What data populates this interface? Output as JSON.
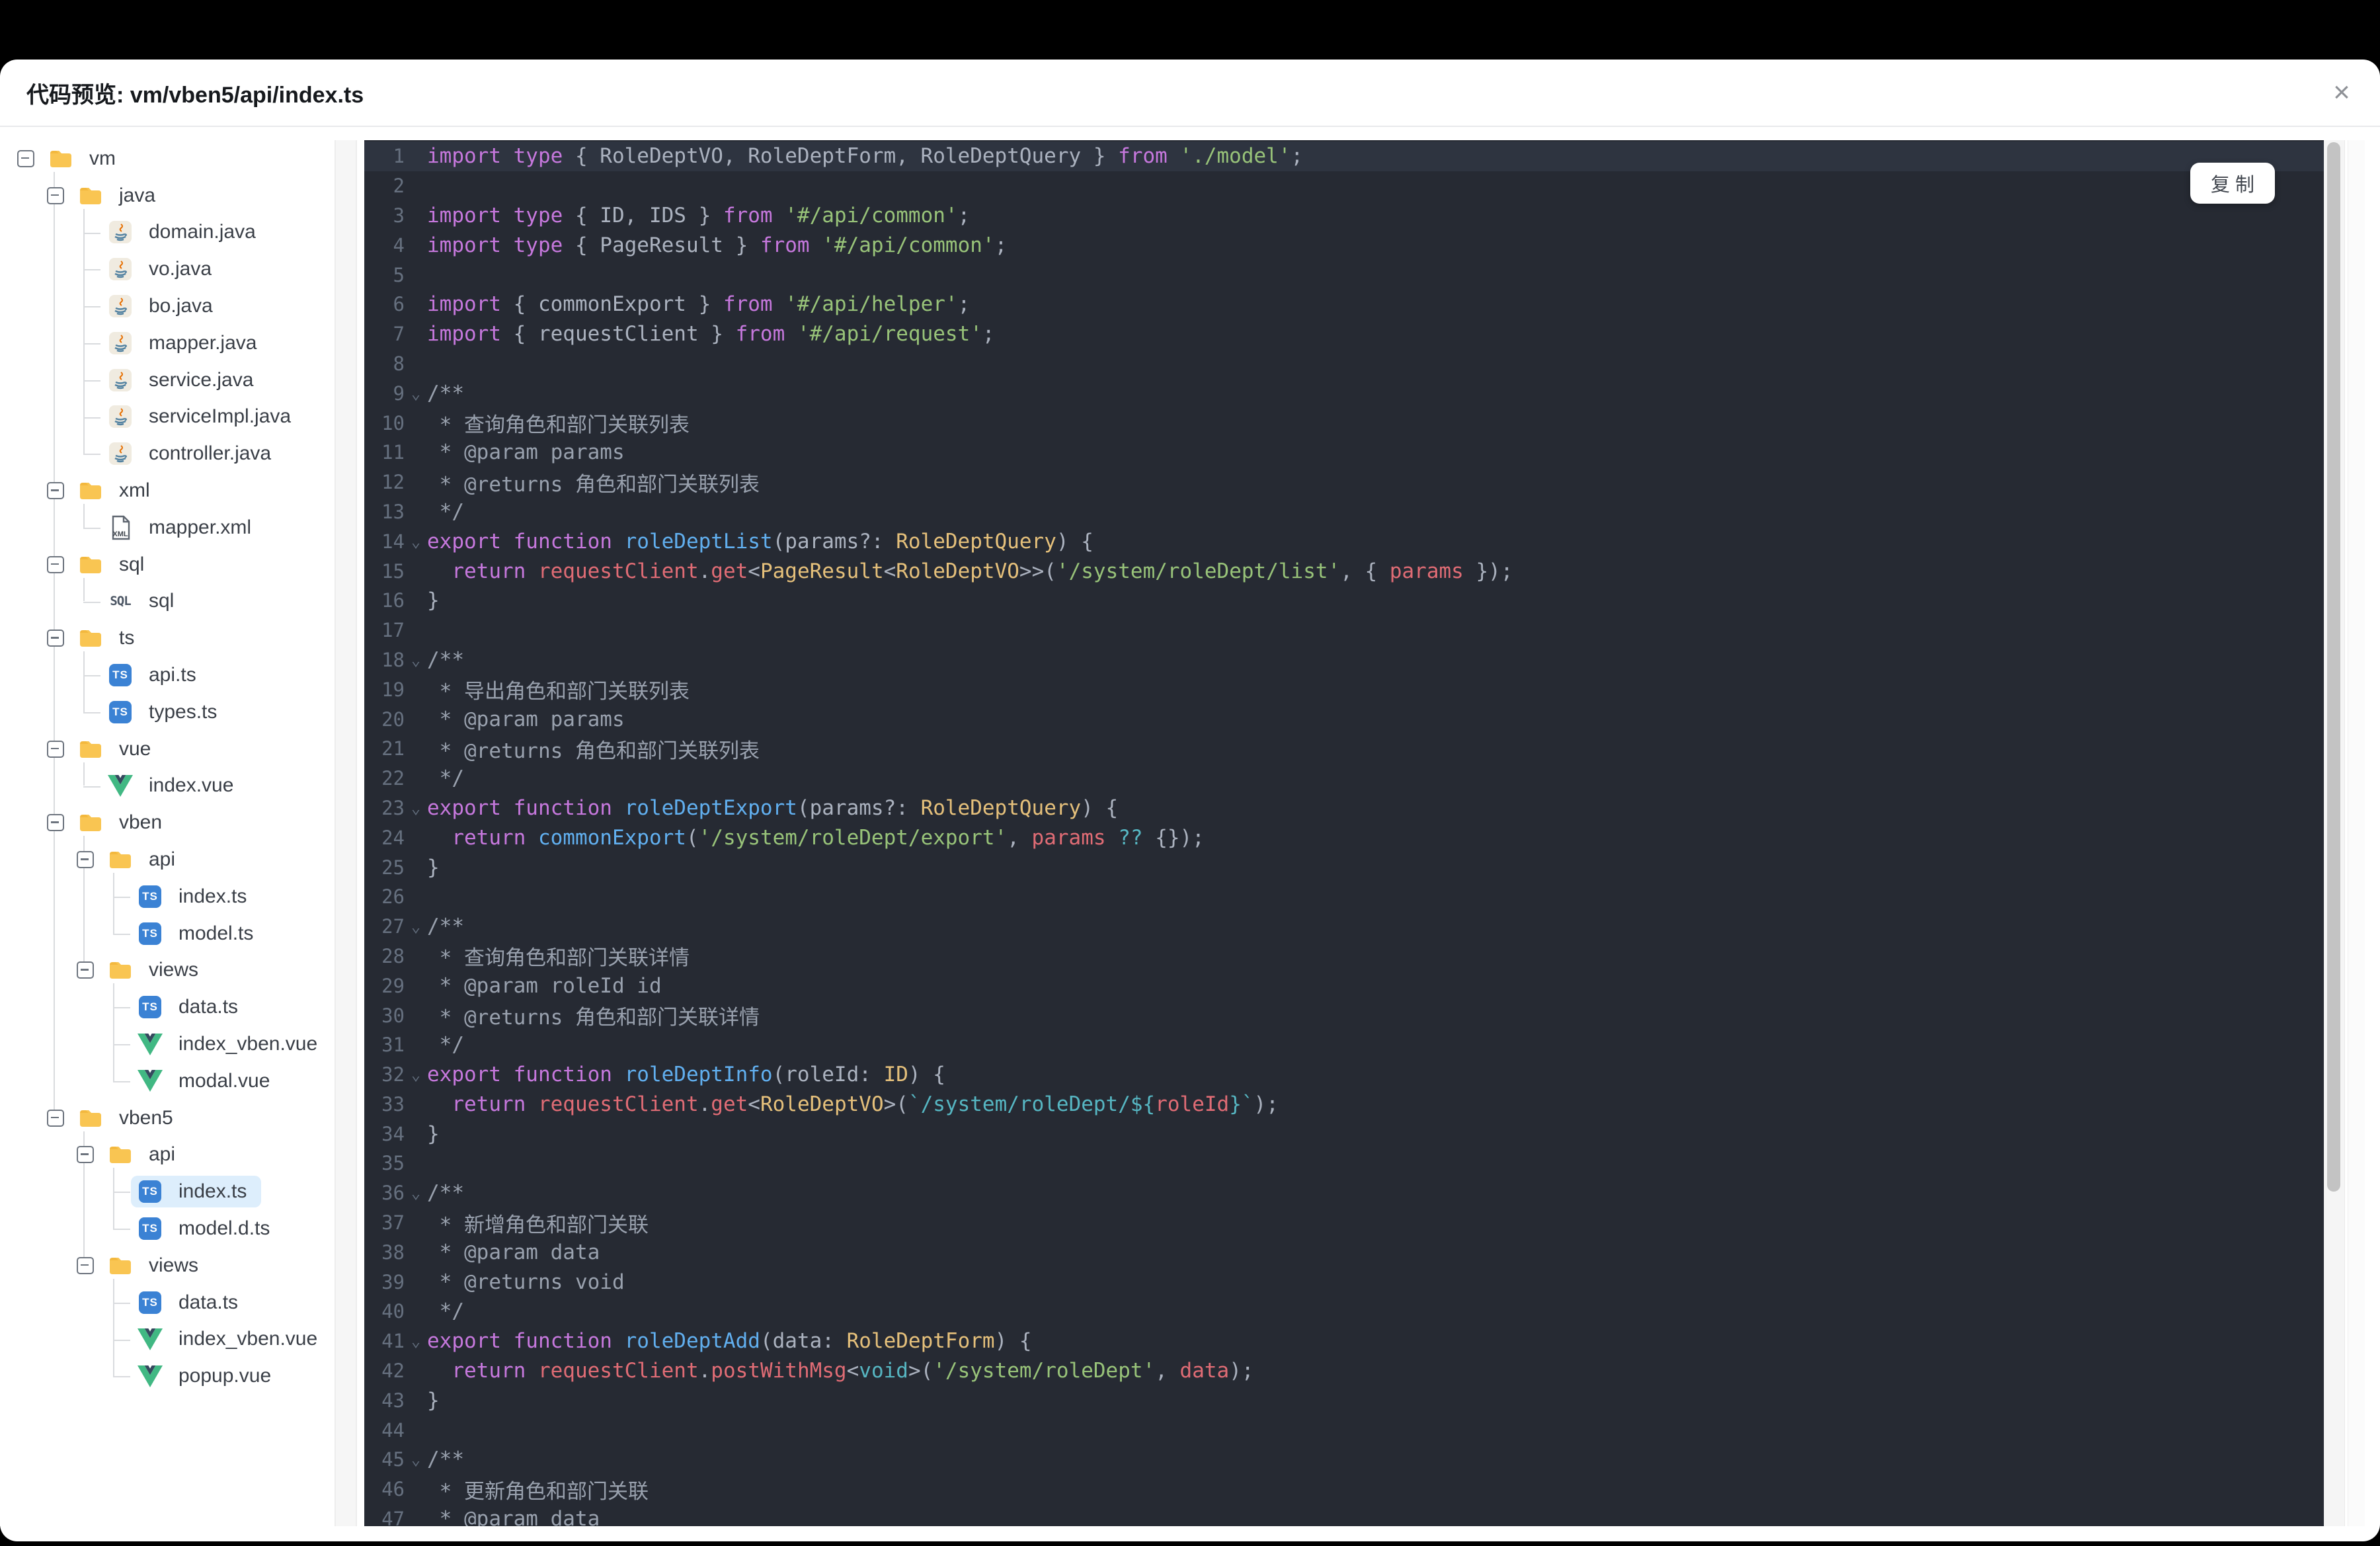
{
  "window": {
    "title": "代码预览: vm/vben5/api/index.ts",
    "close_icon": "×"
  },
  "copy_button": {
    "label": "复 制"
  },
  "colors": {
    "code_background": "#262a33",
    "current_line": "#2e3440",
    "keyword": "#c678dd",
    "string": "#98c379",
    "type": "#e5c07b",
    "function": "#61afef",
    "property": "#e06c75",
    "template_string": "#56b6c2",
    "comment": "#99a1ae",
    "selected_item_bg": "#ddeefc",
    "folder_icon": "#f9c552",
    "ts_badge": "#3b82d4",
    "vue_green": "#41b883"
  },
  "tree": {
    "items": [
      {
        "level": 0,
        "icon": "folder",
        "label": "vm",
        "exp": true
      },
      {
        "level": 1,
        "icon": "folder",
        "label": "java",
        "exp": true
      },
      {
        "level": 2,
        "icon": "java",
        "label": "domain.java"
      },
      {
        "level": 2,
        "icon": "java",
        "label": "vo.java"
      },
      {
        "level": 2,
        "icon": "java",
        "label": "bo.java"
      },
      {
        "level": 2,
        "icon": "java",
        "label": "mapper.java"
      },
      {
        "level": 2,
        "icon": "java",
        "label": "service.java"
      },
      {
        "level": 2,
        "icon": "java",
        "label": "serviceImpl.java"
      },
      {
        "level": 2,
        "icon": "java",
        "label": "controller.java"
      },
      {
        "level": 1,
        "icon": "folder",
        "label": "xml",
        "exp": true
      },
      {
        "level": 2,
        "icon": "xml",
        "label": "mapper.xml"
      },
      {
        "level": 1,
        "icon": "folder",
        "label": "sql",
        "exp": true
      },
      {
        "level": 2,
        "icon": "sql",
        "label": "sql"
      },
      {
        "level": 1,
        "icon": "folder",
        "label": "ts",
        "exp": true
      },
      {
        "level": 2,
        "icon": "ts",
        "label": "api.ts"
      },
      {
        "level": 2,
        "icon": "ts",
        "label": "types.ts"
      },
      {
        "level": 1,
        "icon": "folder",
        "label": "vue",
        "exp": true
      },
      {
        "level": 2,
        "icon": "vue",
        "label": "index.vue"
      },
      {
        "level": 1,
        "icon": "folder",
        "label": "vben",
        "exp": true
      },
      {
        "level": 2,
        "icon": "folder",
        "label": "api",
        "exp": true
      },
      {
        "level": 3,
        "icon": "ts",
        "label": "index.ts"
      },
      {
        "level": 3,
        "icon": "ts",
        "label": "model.ts"
      },
      {
        "level": 2,
        "icon": "folder",
        "label": "views",
        "exp": true
      },
      {
        "level": 3,
        "icon": "ts",
        "label": "data.ts"
      },
      {
        "level": 3,
        "icon": "vue",
        "label": "index_vben.vue"
      },
      {
        "level": 3,
        "icon": "vue",
        "label": "modal.vue"
      },
      {
        "level": 1,
        "icon": "folder",
        "label": "vben5",
        "exp": true
      },
      {
        "level": 2,
        "icon": "folder",
        "label": "api",
        "exp": true
      },
      {
        "level": 3,
        "icon": "ts",
        "label": "index.ts",
        "selected": true
      },
      {
        "level": 3,
        "icon": "ts",
        "label": "model.d.ts"
      },
      {
        "level": 2,
        "icon": "folder",
        "label": "views",
        "exp": true
      },
      {
        "level": 3,
        "icon": "ts",
        "label": "data.ts"
      },
      {
        "level": 3,
        "icon": "vue",
        "label": "index_vben.vue"
      },
      {
        "level": 3,
        "icon": "vue",
        "label": "popup.vue"
      }
    ]
  },
  "code": {
    "fold_glyph": "⌄",
    "lines": [
      {
        "n": 1,
        "hl": true,
        "tokens": [
          [
            "k",
            "import type "
          ],
          [
            "p",
            "{ RoleDeptVO, RoleDeptForm, RoleDeptQuery } "
          ],
          [
            "k",
            "from "
          ],
          [
            "s",
            "'./model'"
          ],
          [
            "p",
            ";"
          ]
        ]
      },
      {
        "n": 2,
        "tokens": []
      },
      {
        "n": 3,
        "tokens": [
          [
            "k",
            "import type "
          ],
          [
            "p",
            "{ ID, IDS } "
          ],
          [
            "k",
            "from "
          ],
          [
            "s",
            "'#/api/common'"
          ],
          [
            "p",
            ";"
          ]
        ]
      },
      {
        "n": 4,
        "tokens": [
          [
            "k",
            "import type "
          ],
          [
            "p",
            "{ PageResult } "
          ],
          [
            "k",
            "from "
          ],
          [
            "s",
            "'#/api/common'"
          ],
          [
            "p",
            ";"
          ]
        ]
      },
      {
        "n": 5,
        "tokens": []
      },
      {
        "n": 6,
        "tokens": [
          [
            "k",
            "import "
          ],
          [
            "p",
            "{ commonExport } "
          ],
          [
            "k",
            "from "
          ],
          [
            "s",
            "'#/api/helper'"
          ],
          [
            "p",
            ";"
          ]
        ]
      },
      {
        "n": 7,
        "tokens": [
          [
            "k",
            "import "
          ],
          [
            "p",
            "{ requestClient } "
          ],
          [
            "k",
            "from "
          ],
          [
            "s",
            "'#/api/request'"
          ],
          [
            "p",
            ";"
          ]
        ]
      },
      {
        "n": 8,
        "tokens": []
      },
      {
        "n": 9,
        "fold": true,
        "tokens": [
          [
            "m",
            "/**"
          ]
        ]
      },
      {
        "n": 10,
        "tokens": [
          [
            "m",
            " * 查询角色和部门关联列表"
          ]
        ]
      },
      {
        "n": 11,
        "tokens": [
          [
            "m",
            " * @param params"
          ]
        ]
      },
      {
        "n": 12,
        "tokens": [
          [
            "m",
            " * @returns 角色和部门关联列表"
          ]
        ]
      },
      {
        "n": 13,
        "tokens": [
          [
            "m",
            " */"
          ]
        ]
      },
      {
        "n": 14,
        "fold": true,
        "tokens": [
          [
            "k",
            "export function "
          ],
          [
            "f",
            "roleDeptList"
          ],
          [
            "p",
            "(params?: "
          ],
          [
            "t",
            "RoleDeptQuery"
          ],
          [
            "p",
            ") {"
          ]
        ]
      },
      {
        "n": 15,
        "tokens": [
          [
            "p",
            "  "
          ],
          [
            "k",
            "return "
          ],
          [
            "r",
            "requestClient"
          ],
          [
            "p",
            "."
          ],
          [
            "r",
            "get"
          ],
          [
            "p",
            "<"
          ],
          [
            "t",
            "PageResult"
          ],
          [
            "p",
            "<"
          ],
          [
            "t",
            "RoleDeptVO"
          ],
          [
            "p",
            ">>("
          ],
          [
            "s",
            "'/system/roleDept/list'"
          ],
          [
            "p",
            ", { "
          ],
          [
            "r",
            "params"
          ],
          [
            "p",
            " });"
          ]
        ]
      },
      {
        "n": 16,
        "tokens": [
          [
            "p",
            "}"
          ]
        ]
      },
      {
        "n": 17,
        "tokens": []
      },
      {
        "n": 18,
        "fold": true,
        "tokens": [
          [
            "m",
            "/**"
          ]
        ]
      },
      {
        "n": 19,
        "tokens": [
          [
            "m",
            " * 导出角色和部门关联列表"
          ]
        ]
      },
      {
        "n": 20,
        "tokens": [
          [
            "m",
            " * @param params"
          ]
        ]
      },
      {
        "n": 21,
        "tokens": [
          [
            "m",
            " * @returns 角色和部门关联列表"
          ]
        ]
      },
      {
        "n": 22,
        "tokens": [
          [
            "m",
            " */"
          ]
        ]
      },
      {
        "n": 23,
        "fold": true,
        "tokens": [
          [
            "k",
            "export function "
          ],
          [
            "f",
            "roleDeptExport"
          ],
          [
            "p",
            "(params?: "
          ],
          [
            "t",
            "RoleDeptQuery"
          ],
          [
            "p",
            ") {"
          ]
        ]
      },
      {
        "n": 24,
        "tokens": [
          [
            "p",
            "  "
          ],
          [
            "k",
            "return "
          ],
          [
            "f",
            "commonExport"
          ],
          [
            "p",
            "("
          ],
          [
            "s",
            "'/system/roleDept/export'"
          ],
          [
            "p",
            ", "
          ],
          [
            "r",
            "params"
          ],
          [
            "p",
            " "
          ],
          [
            "c",
            "??"
          ],
          [
            "p",
            " {});"
          ]
        ]
      },
      {
        "n": 25,
        "tokens": [
          [
            "p",
            "}"
          ]
        ]
      },
      {
        "n": 26,
        "tokens": []
      },
      {
        "n": 27,
        "fold": true,
        "tokens": [
          [
            "m",
            "/**"
          ]
        ]
      },
      {
        "n": 28,
        "tokens": [
          [
            "m",
            " * 查询角色和部门关联详情"
          ]
        ]
      },
      {
        "n": 29,
        "tokens": [
          [
            "m",
            " * @param roleId id"
          ]
        ]
      },
      {
        "n": 30,
        "tokens": [
          [
            "m",
            " * @returns 角色和部门关联详情"
          ]
        ]
      },
      {
        "n": 31,
        "tokens": [
          [
            "m",
            " */"
          ]
        ]
      },
      {
        "n": 32,
        "fold": true,
        "tokens": [
          [
            "k",
            "export function "
          ],
          [
            "f",
            "roleDeptInfo"
          ],
          [
            "p",
            "(roleId: "
          ],
          [
            "t",
            "ID"
          ],
          [
            "p",
            ") {"
          ]
        ]
      },
      {
        "n": 33,
        "tokens": [
          [
            "p",
            "  "
          ],
          [
            "k",
            "return "
          ],
          [
            "r",
            "requestClient"
          ],
          [
            "p",
            "."
          ],
          [
            "r",
            "get"
          ],
          [
            "p",
            "<"
          ],
          [
            "t",
            "RoleDeptVO"
          ],
          [
            "p",
            ">("
          ],
          [
            "c",
            "`/system/roleDept/"
          ],
          [
            "c",
            "${"
          ],
          [
            "r",
            "roleId"
          ],
          [
            "c",
            "}`"
          ],
          [
            "p",
            ");"
          ]
        ]
      },
      {
        "n": 34,
        "tokens": [
          [
            "p",
            "}"
          ]
        ]
      },
      {
        "n": 35,
        "tokens": []
      },
      {
        "n": 36,
        "fold": true,
        "tokens": [
          [
            "m",
            "/**"
          ]
        ]
      },
      {
        "n": 37,
        "tokens": [
          [
            "m",
            " * 新增角色和部门关联"
          ]
        ]
      },
      {
        "n": 38,
        "tokens": [
          [
            "m",
            " * @param data"
          ]
        ]
      },
      {
        "n": 39,
        "tokens": [
          [
            "m",
            " * @returns void"
          ]
        ]
      },
      {
        "n": 40,
        "tokens": [
          [
            "m",
            " */"
          ]
        ]
      },
      {
        "n": 41,
        "fold": true,
        "tokens": [
          [
            "k",
            "export function "
          ],
          [
            "f",
            "roleDeptAdd"
          ],
          [
            "p",
            "(data: "
          ],
          [
            "t",
            "RoleDeptForm"
          ],
          [
            "p",
            ") {"
          ]
        ]
      },
      {
        "n": 42,
        "tokens": [
          [
            "p",
            "  "
          ],
          [
            "k",
            "return "
          ],
          [
            "r",
            "requestClient"
          ],
          [
            "p",
            "."
          ],
          [
            "r",
            "postWithMsg"
          ],
          [
            "p",
            "<"
          ],
          [
            "c",
            "void"
          ],
          [
            "p",
            ">("
          ],
          [
            "s",
            "'/system/roleDept'"
          ],
          [
            "p",
            ", "
          ],
          [
            "r",
            "data"
          ],
          [
            "p",
            ");"
          ]
        ]
      },
      {
        "n": 43,
        "tokens": [
          [
            "p",
            "}"
          ]
        ]
      },
      {
        "n": 44,
        "tokens": []
      },
      {
        "n": 45,
        "fold": true,
        "tokens": [
          [
            "m",
            "/**"
          ]
        ]
      },
      {
        "n": 46,
        "tokens": [
          [
            "m",
            " * 更新角色和部门关联"
          ]
        ]
      },
      {
        "n": 47,
        "tokens": [
          [
            "m",
            " * @param data"
          ]
        ]
      }
    ]
  }
}
